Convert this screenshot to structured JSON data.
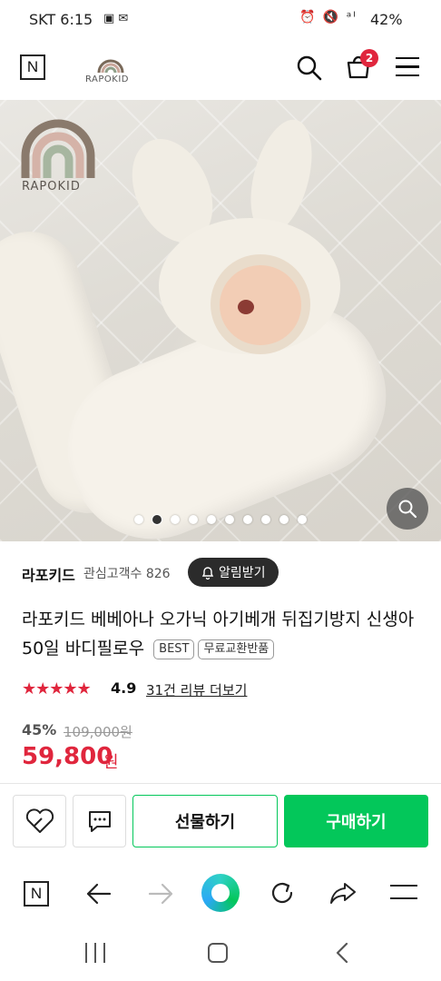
{
  "status_bar": {
    "carrier_time": "SKT 6:15",
    "battery": "42%"
  },
  "header": {
    "logo_text": "RAPOKID",
    "cart_count": "2"
  },
  "hero": {
    "watermark": "RAPOKID",
    "slide_count": 10,
    "active_slide": 2
  },
  "store": {
    "name": "라포키드",
    "fans_label": "관심고객수 826",
    "alarm_label": "알림받기"
  },
  "product": {
    "title": "라포키드 베베아나 오가닉 아기베개 뒤집기방지 신생아 50일 바디필로우",
    "badges": [
      "BEST",
      "무료교환반품"
    ],
    "rating": "4.9",
    "review_link": "31건 리뷰 더보기",
    "discount": "45%",
    "original_price": "109,000원",
    "price": "59,800",
    "currency": "원"
  },
  "actions": {
    "gift_label": "선물하기",
    "buy_label": "구매하기"
  },
  "colors": {
    "accent_green": "#03c75a",
    "price_red": "#e0263d"
  }
}
